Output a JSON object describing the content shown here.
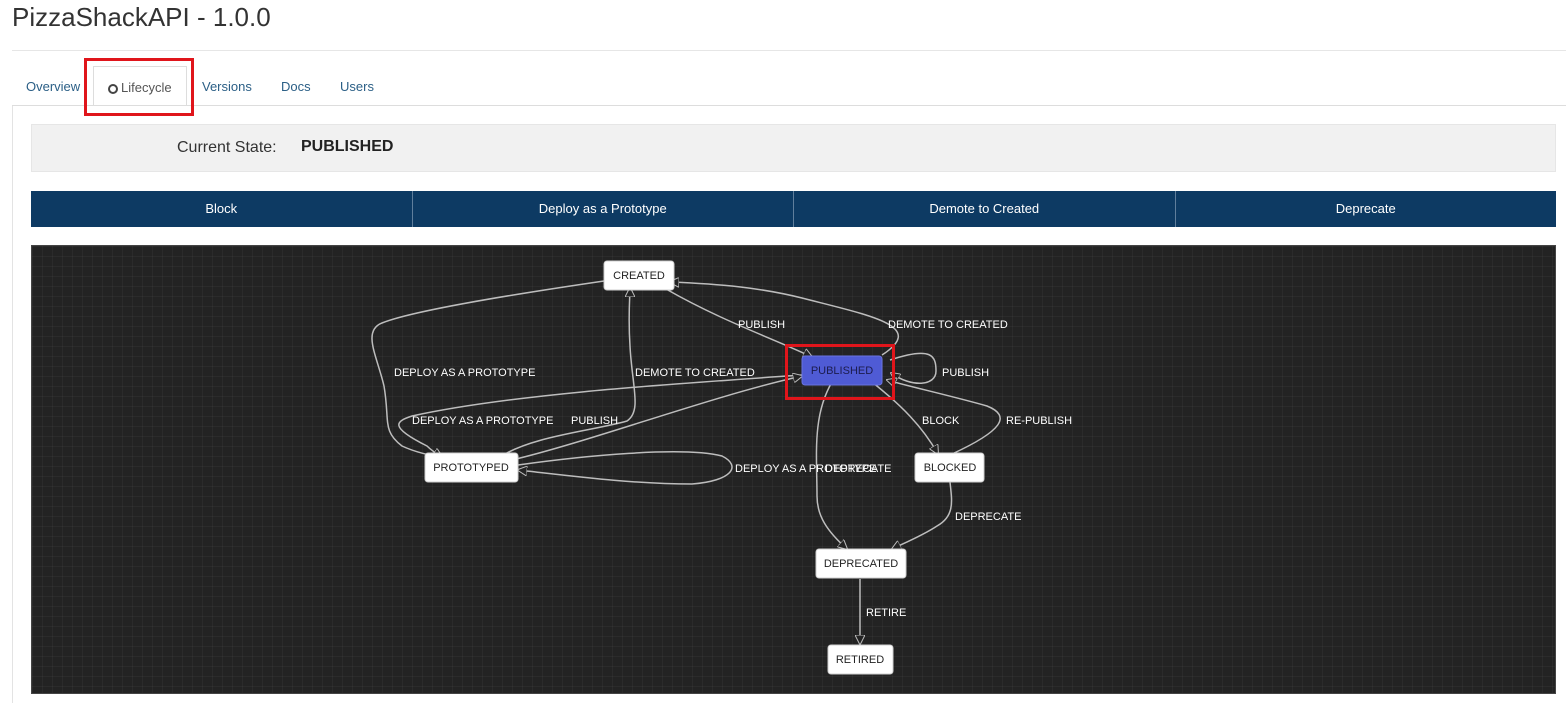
{
  "page": {
    "title": "PizzaShackAPI - 1.0.0"
  },
  "tabs": [
    {
      "label": "Overview"
    },
    {
      "label": "Lifecycle",
      "icon": "lifecycle-icon",
      "active": true
    },
    {
      "label": "Versions"
    },
    {
      "label": "Docs"
    },
    {
      "label": "Users"
    }
  ],
  "state": {
    "label": "Current State:",
    "value": "PUBLISHED"
  },
  "actions": [
    {
      "label": "Block"
    },
    {
      "label": "Deploy as a Prototype"
    },
    {
      "label": "Demote to Created"
    },
    {
      "label": "Deprecate"
    }
  ],
  "diagram": {
    "nodes": {
      "created": "CREATED",
      "published": "PUBLISHED",
      "prototyped": "PROTOTYPED",
      "blocked": "BLOCKED",
      "deprecated": "DEPRECATED",
      "retired": "RETIRED"
    },
    "edge_labels": {
      "publish_top": "PUBLISH",
      "demote_top": "DEMOTE TO CREATED",
      "deploy_left": "DEPLOY AS A PROTOTYPE",
      "demote_mid": "DEMOTE TO CREATED",
      "publish_self": "PUBLISH",
      "deploy_mid": "DEPLOY AS A PROTOTYPE",
      "publish_mid": "PUBLISH",
      "block": "BLOCK",
      "republish": "RE-PUBLISH",
      "deploy_self": "DEPLOY AS A PROTOTYPE",
      "deprecate_pub": "DEPRECATE",
      "deprecate_blk": "DEPRECATE",
      "retire": "RETIRE"
    },
    "current_color": "#4f5bd5"
  },
  "colors": {
    "action_bar": "#0d3a63",
    "highlight": "#e0151b",
    "link": "#2b5f86"
  }
}
